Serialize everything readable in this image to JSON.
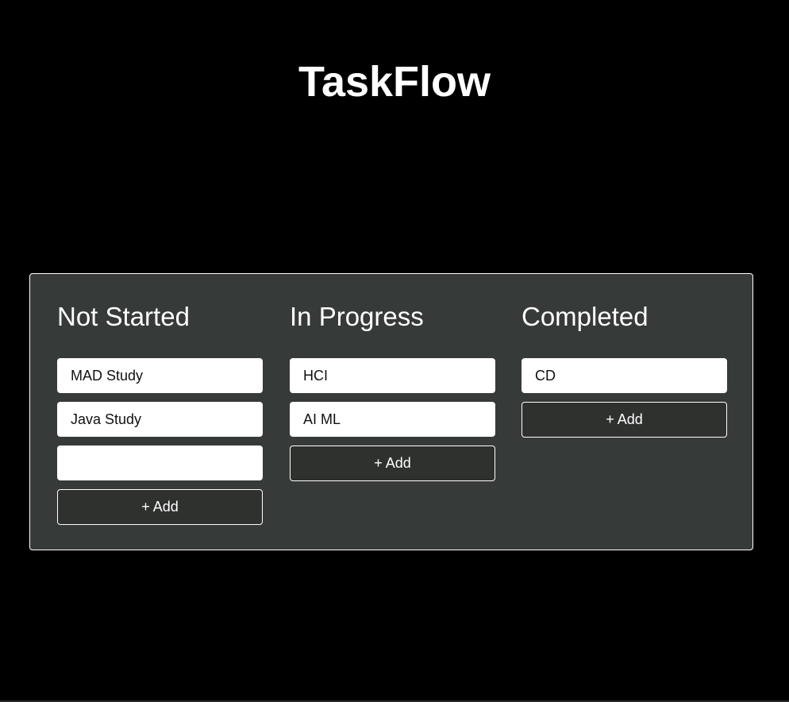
{
  "app": {
    "title": "TaskFlow"
  },
  "colors": {
    "background": "#000000",
    "board_background": "#363a38",
    "card_background": "#ffffff",
    "button_background": "#2f312f",
    "border": "#ffffff"
  },
  "board": {
    "columns": [
      {
        "title": "Not Started",
        "cards": [
          "MAD Study",
          "Java Study",
          ""
        ],
        "add_label": "+ Add"
      },
      {
        "title": "In Progress",
        "cards": [
          "HCI",
          "AI ML"
        ],
        "add_label": "+ Add"
      },
      {
        "title": "Completed",
        "cards": [
          "CD"
        ],
        "add_label": "+ Add"
      }
    ]
  }
}
